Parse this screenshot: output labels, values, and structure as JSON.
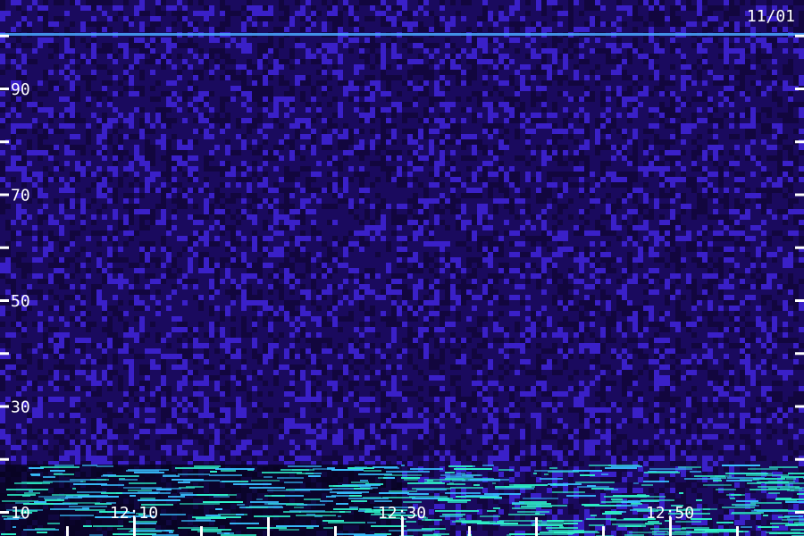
{
  "chart_data": {
    "type": "heatmap",
    "date_label": "11/01",
    "y_ticks": [
      {
        "value": 10,
        "label": "10"
      },
      {
        "value": 20,
        "label": ""
      },
      {
        "value": 30,
        "label": "30"
      },
      {
        "value": 40,
        "label": ""
      },
      {
        "value": 50,
        "label": "50"
      },
      {
        "value": 60,
        "label": ""
      },
      {
        "value": 70,
        "label": "70"
      },
      {
        "value": 80,
        "label": ""
      },
      {
        "value": 90,
        "label": "90"
      },
      {
        "value": 100,
        "label": ""
      }
    ],
    "x_ticks": [
      {
        "value": "12:05",
        "label": ""
      },
      {
        "value": "12:10",
        "label": "12:10"
      },
      {
        "value": "12:15",
        "label": ""
      },
      {
        "value": "12:20",
        "label": ""
      },
      {
        "value": "12:25",
        "label": ""
      },
      {
        "value": "12:30",
        "label": "12:30"
      },
      {
        "value": "12:35",
        "label": ""
      },
      {
        "value": "12:40",
        "label": ""
      },
      {
        "value": "12:45",
        "label": ""
      },
      {
        "value": "12:50",
        "label": "12:50"
      },
      {
        "value": "12:55",
        "label": ""
      }
    ],
    "colors": {
      "background": "#1a0a5e",
      "noise_low": "#12063f",
      "noise_mid": "#3a20c8",
      "noise_high": "#5a3cff",
      "strong": "#2ef0c8",
      "strong_alt": "#38c0ff",
      "ticks": "#ffffff"
    }
  }
}
